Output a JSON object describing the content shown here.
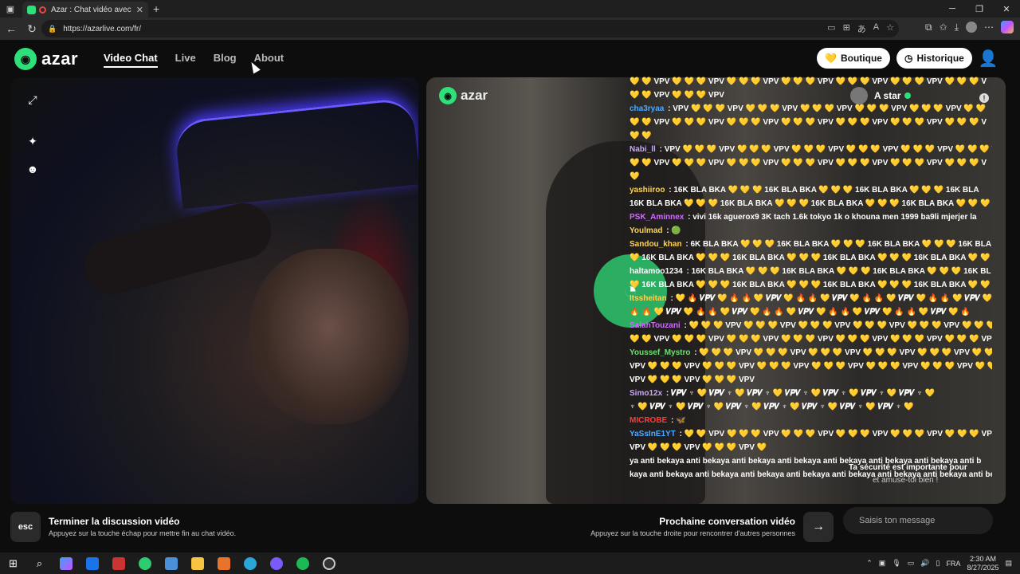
{
  "browser": {
    "tab_title": "Azar : Chat vidéo avec de no",
    "tab_close": "✕",
    "new_tab": "+",
    "url": "https://azarlive.com/fr/"
  },
  "site": {
    "logo_text": "azar",
    "nav": [
      "Video Chat",
      "Live",
      "Blog",
      "About"
    ],
    "boutique_label": "Boutique",
    "historique_label": "Historique"
  },
  "partner": {
    "logo_text": "azar",
    "name": "A star"
  },
  "safety": {
    "line1": "Ta sécurité est importante pour",
    "line2": "et amuse-toi bien !"
  },
  "chat": [
    {
      "user": "",
      "color": "#ffffff",
      "text": "💛 💛 VPV 💛 💛 💛 VPV 💛 💛 💛 VPV 💛 💛 💛 VPV 💛 💛 💛 VPV 💛 💛 💛 VPV 💛 💛 💛 V"
    },
    {
      "user": "",
      "color": "#ffffff",
      "text": "💛 💛 VPV 💛 💛 💛 VPV"
    },
    {
      "user": "cha3ryaa",
      "color": "#4fa8ff",
      "text": "VPV 💛 💛 💛 VPV 💛 💛 💛 VPV 💛 💛 💛 VPV 💛 💛 💛 VPV 💛 💛 💛 VPV 💛 💛"
    },
    {
      "user": "",
      "color": "#ffffff",
      "text": "💛 💛 VPV 💛 💛 💛 VPV 💛 💛 💛 VPV 💛 💛 💛 VPV 💛 💛 💛 VPV 💛 💛 💛 VPV 💛 💛 💛 V"
    },
    {
      "user": "",
      "color": "#ffffff",
      "text": "💛 💛"
    },
    {
      "user": "Nabi_ll",
      "color": "#c9a6ff",
      "text": "VPV 💛 💛 💛 VPV 💛 💛 💛 VPV 💛 💛 💛 VPV 💛 💛 💛 VPV 💛 💛 💛 VPV 💛 💛 💛 VI"
    },
    {
      "user": "",
      "color": "#ffffff",
      "text": "💛 💛 VPV 💛 💛 💛 VPV 💛 💛 💛 VPV 💛 💛 💛 VPV 💛 💛 💛 VPV 💛 💛 💛 VPV 💛 💛 💛 V"
    },
    {
      "user": "",
      "color": "#ffffff",
      "text": "💛"
    },
    {
      "user": "yashiiroo",
      "color": "#ffd34f",
      "text": "16K BLA BKA 💛 💛 💛 16K BLA BKA 💛 💛 💛 16K BLA BKA 💛 💛 💛 16K BLA"
    },
    {
      "user": "",
      "color": "#ffffff",
      "text": "16K BLA BKA 💛 💛 💛 16K BLA BKA 💛 💛 💛 16K BLA BKA 💛 💛 💛 16K BLA BKA 💛 💛 💛 1"
    },
    {
      "user": "PSK_Aminnex",
      "color": "#d06bff",
      "text": "vivi 16k aguerox9 3K tach 1.6k tokyo 1k o khouna men 1999 ba9li mjerjer la"
    },
    {
      "user": "Youlmad",
      "color": "#ffd34f",
      "text": "🟢"
    },
    {
      "user": "Sandou_khan",
      "color": "#ffd34f",
      "text": "6K BLA BKA 💛 💛 💛 16K BLA BKA 💛 💛 💛 16K BLA BKA 💛 💛 💛 16K BLA"
    },
    {
      "user": "",
      "color": "#ffffff",
      "text": "💛 16K BLA BKA 💛 💛 💛 16K BLA BKA 💛 💛 💛 16K BLA BKA 💛 💛 💛 16K BLA BKA 💛 💛 💛"
    },
    {
      "user": "haltamoo1234",
      "color": "#ffffff",
      "text": "16K BLA BKA 💛 💛 💛 16K BLA BKA 💛 💛 💛 16K BLA BKA 💛 💛 💛 16K BL"
    },
    {
      "user": "",
      "color": "#ffffff",
      "text": "💛 16K BLA BKA 💛 💛 💛 16K BLA BKA 💛 💛 💛 16K BLA BKA 💛 💛 💛 16K BLA BKA 💛 💛"
    },
    {
      "user": "Itssheitan",
      "color": "#ffd34f",
      "text": "💛 🔥 𝑽𝑷𝑽 💛 🔥 🔥 💛 𝑽𝑷𝑽 💛 🔥 🔥 💛 𝑽𝑷𝑽 💛 🔥 🔥 💛 𝑽𝑷𝑽 💛 🔥 🔥 💛 𝑽𝑷𝑽 💛"
    },
    {
      "user": "",
      "color": "#ffffff",
      "text": "🔥 🔥 💛 𝑽𝑷𝑽 💛 🔥 🔥 💛 𝑽𝑷𝑽 💛 🔥 🔥 💛 𝑽𝑷𝑽 💛 🔥 🔥 💛 𝑽𝑷𝑽 💛 🔥 🔥 💛 𝑽𝑷𝑽 💛 🔥"
    },
    {
      "user": "SalahTouzani",
      "color": "#d06bff",
      "text": "💛 💛 💛 VPV 💛 💛 💛 VPV 💛 💛 💛 VPV 💛 💛 💛 VPV 💛 💛 💛 VPV 💛 💛 💛 VP"
    },
    {
      "user": "",
      "color": "#ffffff",
      "text": "💛 💛 VPV 💛 💛 💛 VPV 💛 💛 💛 VPV 💛 💛 💛 VPV 💛 💛 💛 VPV 💛 💛 💛 VPV 💛 💛 💛 VPV"
    },
    {
      "user": "Youssef_Mystro",
      "color": "#6fe06f",
      "text": "💛 💛 💛 VPV 💛 💛 💛 VPV 💛 💛 💛 VPV 💛 💛 💛 VPV 💛 💛 💛 VPV 💛 💛 💛"
    },
    {
      "user": "",
      "color": "#ffffff",
      "text": "VPV 💛 💛 💛 VPV 💛 💛 💛 VPV 💛 💛 💛 VPV 💛 💛 💛 VPV 💛 💛 💛 VPV 💛 💛 💛 VPV 💛 💛"
    },
    {
      "user": "",
      "color": "#ffffff",
      "text": "VPV 💛 💛 💛 VPV 💛 💛 💛 VPV"
    },
    {
      "user": "Simo12x",
      "color": "#c9a6ff",
      "text": "𝑽𝑷𝑽 ♆ 💛 𝑽𝑷𝑽 ♆ 💛 𝑽𝑷𝑽 ♆ 💛 𝑽𝑷𝑽 ♆ 💛 𝑽𝑷𝑽 ♆ 💛 𝑽𝑷𝑽 ♆ 💛 𝑽𝑷𝑽 ♆ 💛"
    },
    {
      "user": "",
      "color": "#ffffff",
      "text": "♆ 💛 𝑽𝑷𝑽 ♆ 💛 𝑽𝑷𝑽 ♆ 💛 𝑽𝑷𝑽 ♆ 💛 𝑽𝑷𝑽 ♆ 💛 𝑽𝑷𝑽 ♆ 💛 𝑽𝑷𝑽 ♆ 💛 𝑽𝑷𝑽 ♆ 💛"
    },
    {
      "user": "MICROBE",
      "color": "#ff3b3b",
      "text": "🦋"
    },
    {
      "user": "YaSsInE1YT",
      "color": "#4fa8ff",
      "text": "💛 💛 VPV 💛 💛 💛 VPV 💛 💛 💛 VPV 💛 💛 💛 VPV 💛 💛 💛 VPV 💛 💛 💛 VPV 💛 💛 💛 VP"
    },
    {
      "user": "",
      "color": "#ffffff",
      "text": "VPV 💛 💛 💛 VPV 💛 💛 💛 VPV 💛"
    },
    {
      "user": "",
      "color": "#ffffff",
      "text": "ya anti bekaya anti bekaya anti bekaya anti bekaya anti bekaya anti bekaya anti bekaya anti b"
    },
    {
      "user": "",
      "color": "#ffffff",
      "text": "kaya anti bekaya anti bekaya anti bekaya anti bekaya anti bekaya anti bekaya anti bekaya anti be"
    }
  ],
  "bottom": {
    "esc_label": "esc",
    "end_title": "Terminer la discussion vidéo",
    "end_sub": "Appuyez sur la touche échap pour mettre fin au chat vidéo.",
    "next_title": "Prochaine conversation vidéo",
    "next_sub": "Appuyez sur la touche droite pour rencontrer d'autres personnes",
    "message_placeholder": "Saisis ton message"
  },
  "taskbar": {
    "lang": "FRA",
    "time": "2:30 AM",
    "date": "8/27/2025"
  }
}
